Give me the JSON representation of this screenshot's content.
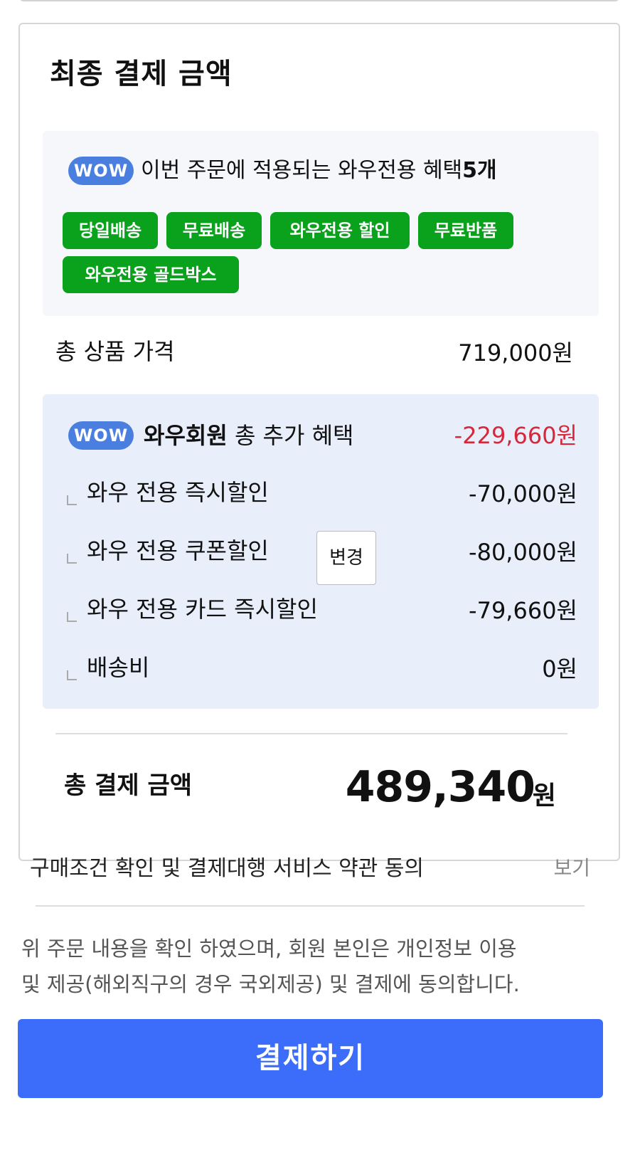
{
  "summary": {
    "title": "최종 결제 금액",
    "wow_badge": "WOW",
    "benefits": {
      "headline_prefix": "이번 주문에 적용되는 와우전용 혜택",
      "headline_count": "5개",
      "tags": [
        "당일배송",
        "무료배송",
        "와우전용 할인",
        "무료반품",
        "와우전용 골드박스"
      ]
    },
    "product_total": {
      "label": "총 상품 가격",
      "value": "719,000원"
    },
    "wow_discounts": {
      "badge": "WOW",
      "member_label": "와우회원",
      "label_suffix": "총 추가 혜택",
      "total": "-229,660원",
      "accent_color": "#d6283a",
      "items": [
        {
          "label": "와우 전용 즉시할인",
          "value": "-70,000원"
        },
        {
          "label": "와우 전용 쿠폰할인",
          "value": "-80,000원",
          "action": "변경"
        },
        {
          "label": "와우 전용 카드 즉시할인",
          "value": "-79,660원"
        },
        {
          "label": "배송비",
          "value": "0원"
        }
      ]
    },
    "final_total": {
      "label": "총 결제 금액",
      "amount": "489,340",
      "unit": "원"
    }
  },
  "agreement": {
    "label": "구매조건 확인 및 결제대행 서비스 약관 동의",
    "view_link": "보기",
    "notice_line1": "위 주문 내용을 확인 하였으며, 회원 본인은 개인정보 이용",
    "notice_line2": "및 제공(해외직구의 경우 국외제공) 및 결제에 동의합니다."
  },
  "pay_button": {
    "label": "결제하기",
    "color": "#3c6dfa"
  },
  "colors": {
    "tag_green": "#0aa21c",
    "wow_blue": "#4a7fe0",
    "discount_bg": "#e9eefb"
  }
}
